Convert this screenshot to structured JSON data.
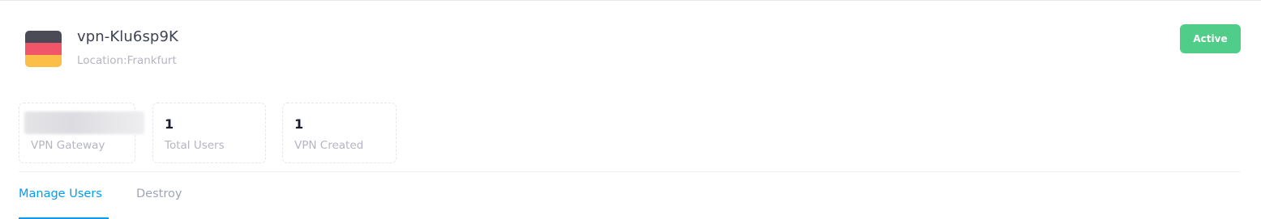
{
  "header": {
    "title": "vpn-Klu6sp9K",
    "subtitle": "Location:Frankfurt",
    "flag_icon": "germany-flag-icon",
    "flag_colors": [
      "#4a4b57",
      "#f0556a",
      "#fbbf47"
    ]
  },
  "status": {
    "label": "Active",
    "color": "#50cd89"
  },
  "stats": [
    {
      "value": "",
      "label": "VPN Gateway",
      "redacted": true
    },
    {
      "value": "1",
      "label": "Total Users"
    },
    {
      "value": "1",
      "label": "VPN Created"
    }
  ],
  "tabs": [
    {
      "label": "Manage Users",
      "active": true
    },
    {
      "label": "Destroy",
      "active": false
    }
  ],
  "colors": {
    "accent": "#009ef7",
    "muted": "#b5b5c3",
    "heading": "#3f4254"
  }
}
